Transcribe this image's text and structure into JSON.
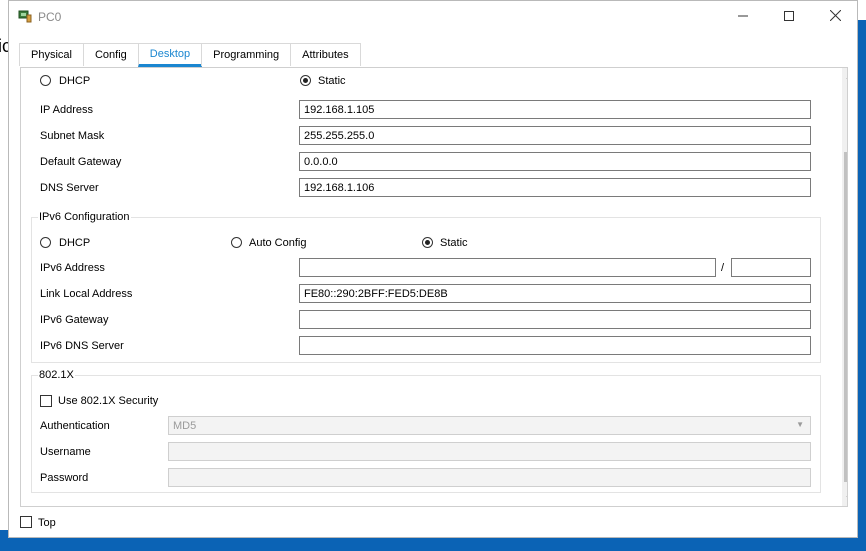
{
  "window": {
    "title": "PC0"
  },
  "tabs": [
    "Physical",
    "Config",
    "Desktop",
    "Programming",
    "Attributes"
  ],
  "ipv4": {
    "dhcp_label": "DHCP",
    "static_label": "Static",
    "mode": "static",
    "fields": [
      {
        "label": "IP Address",
        "value": "192.168.1.105"
      },
      {
        "label": "Subnet Mask",
        "value": "255.255.255.0"
      },
      {
        "label": "Default Gateway",
        "value": "0.0.0.0"
      },
      {
        "label": "DNS Server",
        "value": "192.168.1.106"
      }
    ]
  },
  "ipv6": {
    "title": "IPv6 Configuration",
    "dhcp_label": "DHCP",
    "auto_label": "Auto Config",
    "static_label": "Static",
    "mode": "static",
    "address_label": "IPv6 Address",
    "address_value": "",
    "prefix_separator": "/",
    "prefix_value": "",
    "link_local_label": "Link Local Address",
    "link_local_value": "FE80::290:2BFF:FED5:DE8B",
    "gateway_label": "IPv6 Gateway",
    "gateway_value": "",
    "dns_label": "IPv6 DNS Server",
    "dns_value": ""
  },
  "dot1x": {
    "title": "802.1X",
    "use_label": "Use 802.1X Security",
    "use_checked": false,
    "auth_label": "Authentication",
    "auth_value": "MD5",
    "username_label": "Username",
    "username_value": "",
    "password_label": "Password",
    "password_value": ""
  },
  "footer": {
    "top_label": "Top",
    "top_checked": false
  },
  "background": {
    "left_glyph": "ic"
  }
}
